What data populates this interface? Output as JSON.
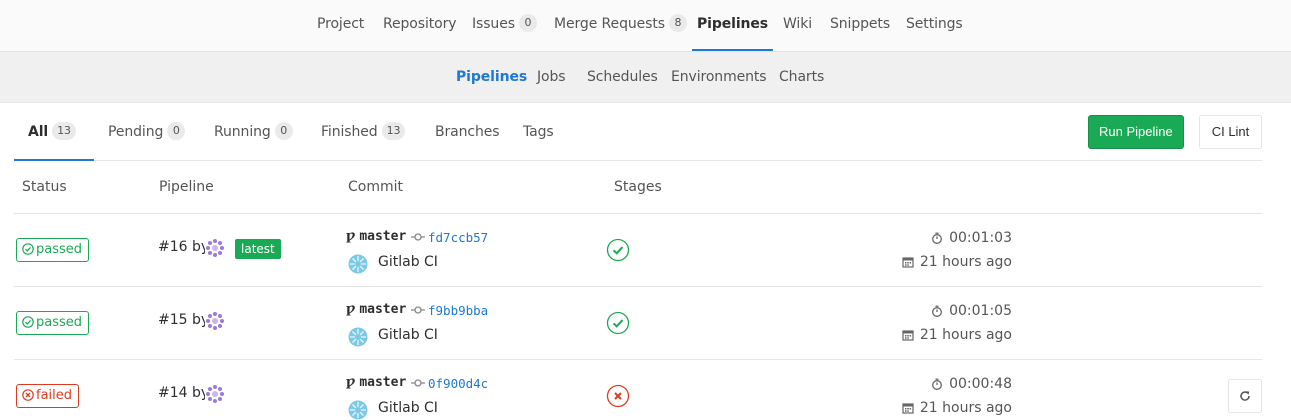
{
  "project_nav": [
    {
      "label": "Project"
    },
    {
      "label": "Repository"
    },
    {
      "label": "Issues",
      "count": "0"
    },
    {
      "label": "Merge Requests",
      "count": "8"
    },
    {
      "label": "Pipelines",
      "active": true
    },
    {
      "label": "Wiki"
    },
    {
      "label": "Snippets"
    },
    {
      "label": "Settings"
    }
  ],
  "sub_nav": [
    {
      "label": "Pipelines",
      "active": true
    },
    {
      "label": "Jobs"
    },
    {
      "label": "Schedules"
    },
    {
      "label": "Environments"
    },
    {
      "label": "Charts"
    }
  ],
  "scope_tabs": [
    {
      "label": "All",
      "count": "13",
      "active": true
    },
    {
      "label": "Pending",
      "count": "0"
    },
    {
      "label": "Running",
      "count": "0"
    },
    {
      "label": "Finished",
      "count": "13"
    },
    {
      "label": "Branches"
    },
    {
      "label": "Tags"
    }
  ],
  "actions": {
    "run_pipeline": "Run Pipeline",
    "ci_lint": "CI Lint"
  },
  "columns": {
    "status": "Status",
    "pipeline": "Pipeline",
    "commit": "Commit",
    "stages": "Stages"
  },
  "pipelines": [
    {
      "status": "passed",
      "id": "#16 by",
      "latest": "latest",
      "branch": "master",
      "sha": "fd7ccb57",
      "author": "Gitlab CI",
      "stage": "success",
      "duration": "00:01:03",
      "finished": "21 hours ago"
    },
    {
      "status": "passed",
      "id": "#15 by",
      "branch": "master",
      "sha": "f9bb9bba",
      "author": "Gitlab CI",
      "stage": "success",
      "duration": "00:01:05",
      "finished": "21 hours ago"
    },
    {
      "status": "failed",
      "id": "#14 by",
      "branch": "master",
      "sha": "0f900d4c",
      "author": "Gitlab CI",
      "stage": "failed",
      "duration": "00:00:48",
      "finished": "21 hours ago",
      "retry": true
    }
  ],
  "colors": {
    "success": "#1aaa55",
    "failed": "#db3b21",
    "link": "#1f78d1",
    "active_tab": "#1f78d1"
  }
}
